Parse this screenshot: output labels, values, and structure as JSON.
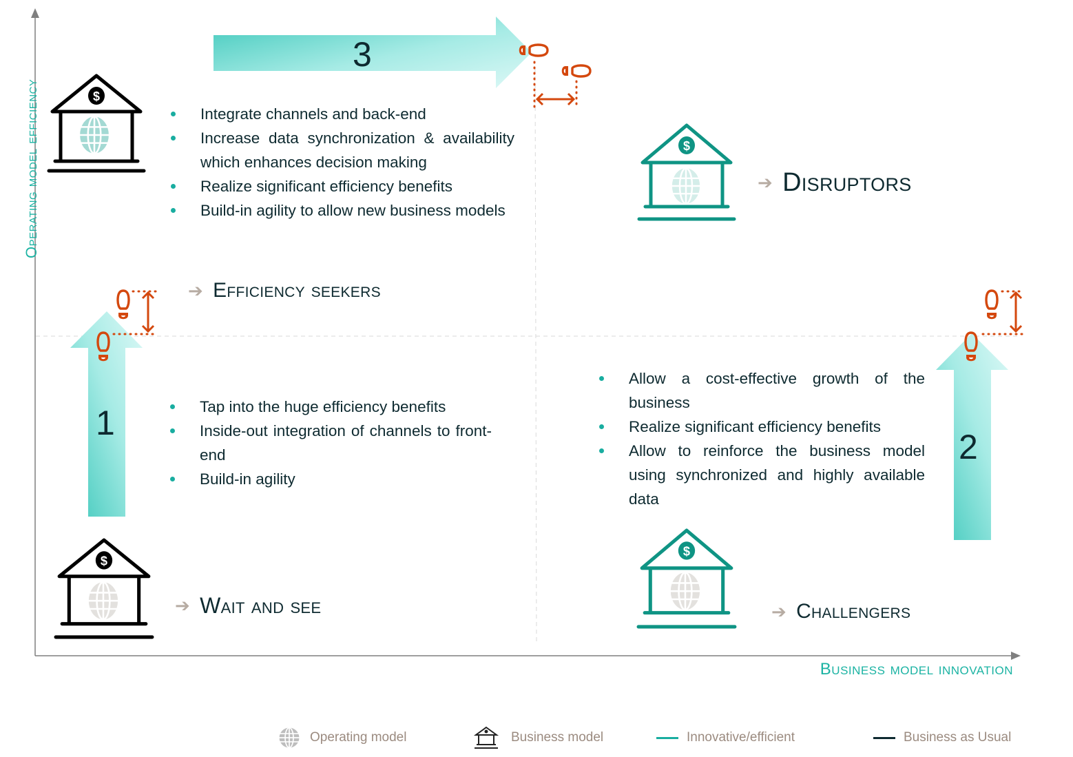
{
  "axes": {
    "y_title": "Operating model efficiency",
    "x_title": "Business model innovation"
  },
  "colors": {
    "teal": "#1bb3a3",
    "dark_teal": "#0f9484",
    "navy": "#0e2a30",
    "orange": "#d4480e",
    "arrow_grey": "#b7aca3",
    "legend_text": "#9b8b80"
  },
  "quadrants": {
    "efficiency_seekers": {
      "label": "Efficiency seekers",
      "arrow_icon": "arrow-right-icon",
      "bullets": [
        "Integrate channels and back-end",
        "Increase data synchronization & availability which enhances decision making",
        "Realize significant efficiency benefits",
        "Build-in agility to allow new business models"
      ]
    },
    "disruptors": {
      "label": "Disruptors",
      "arrow_icon": "arrow-right-icon"
    },
    "wait_and_see": {
      "label": "Wait and see",
      "arrow_icon": "arrow-right-icon",
      "bullets": [
        "Tap into the huge efficiency benefits",
        "Inside-out integration of channels to front-end",
        "Build-in agility"
      ]
    },
    "challengers": {
      "label": "Challengers",
      "arrow_icon": "arrow-right-icon",
      "bullets": [
        "Allow a cost-effective growth of the business",
        "Realize significant efficiency benefits",
        "Allow to reinforce the business model using synchronized and highly available data"
      ]
    }
  },
  "steps": {
    "one": "1",
    "two": "2",
    "three": "3"
  },
  "arrow_glyph": "➔",
  "legend": [
    {
      "icon": "globe-icon",
      "label": "Operating model"
    },
    {
      "icon": "bank-icon",
      "label": "Business model"
    },
    {
      "icon": "teal-line",
      "label": "Innovative/efficient"
    },
    {
      "icon": "navy-line",
      "label": "Business as Usual"
    }
  ]
}
